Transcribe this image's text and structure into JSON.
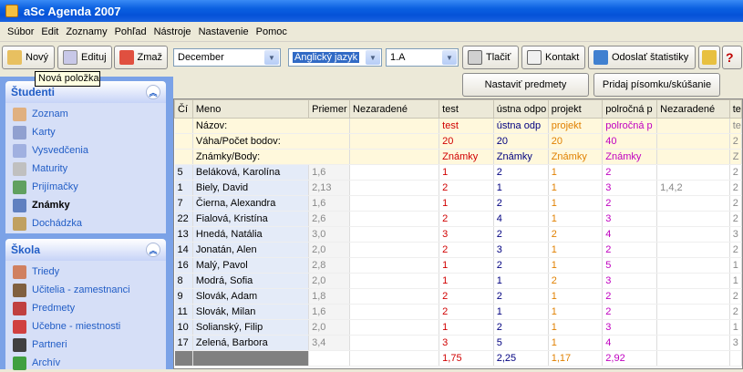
{
  "window": {
    "title": "aSc Agenda 2007"
  },
  "menu": [
    "Súbor",
    "Edit",
    "Zoznamy",
    "Pohľad",
    "Nástroje",
    "Nastavenie",
    "Pomoc"
  ],
  "toolbar": {
    "new": "Nový",
    "edit": "Edituj",
    "delete": "Zmaž",
    "month": "December",
    "subject": "Anglický jazyk",
    "class": "1.A",
    "print": "Tlačiť",
    "contact": "Kontakt",
    "send_stats": "Odoslať štatistiky",
    "set_subjects": "Nastaviť predmety",
    "add_exam": "Pridaj písomku/skúšanie",
    "tooltip": "Nová položka"
  },
  "sidebar": {
    "students_title": "Študenti",
    "students": [
      "Zoznam",
      "Karty",
      "Vysvedčenia",
      "Maturity",
      "Prijímačky",
      "Známky",
      "Dochádzka"
    ],
    "school_title": "Škola",
    "school": [
      "Triedy",
      "Učitelia - zamestnanci",
      "Predmety",
      "Učebne - miestnosti",
      "Partneri",
      "Archív"
    ]
  },
  "grid": {
    "headers": [
      "Čí",
      "Meno",
      "Priemer",
      "Nezaradené",
      "test",
      "ústna odpo",
      "projekt",
      "polročná p",
      "Nezaradené",
      "te"
    ],
    "meta": [
      {
        "label": "Názov:",
        "vals": [
          "test",
          "ústna odp",
          "projekt",
          "polročná p",
          "",
          "te"
        ]
      },
      {
        "label": "Váha/Počet bodov:",
        "vals": [
          "20",
          "20",
          "20",
          "40",
          "",
          "2"
        ]
      },
      {
        "label": "Známky/Body:",
        "vals": [
          "Známky",
          "Známky",
          "Známky",
          "Známky",
          "",
          "Z"
        ]
      }
    ],
    "rows": [
      {
        "n": "5",
        "name": "Beláková, Karolína",
        "avg": "1,6",
        "nez": "",
        "t": "1",
        "u": "2",
        "p": "1",
        "pol": "2",
        "nez2": "",
        "x": "2"
      },
      {
        "n": "1",
        "name": "Biely, David",
        "avg": "2,13",
        "nez": "",
        "t": "2",
        "u": "1",
        "p": "1",
        "pol": "3",
        "nez2": "1,4,2",
        "x": "2"
      },
      {
        "n": "7",
        "name": "Čierna, Alexandra",
        "avg": "1,6",
        "nez": "",
        "t": "1",
        "u": "2",
        "p": "1",
        "pol": "2",
        "nez2": "",
        "x": "2"
      },
      {
        "n": "22",
        "name": "Fialová, Kristína",
        "avg": "2,6",
        "nez": "",
        "t": "2",
        "u": "4",
        "p": "1",
        "pol": "3",
        "nez2": "",
        "x": "2"
      },
      {
        "n": "13",
        "name": "Hnedá, Natália",
        "avg": "3,0",
        "nez": "",
        "t": "3",
        "u": "2",
        "p": "2",
        "pol": "4",
        "nez2": "",
        "x": "3"
      },
      {
        "n": "14",
        "name": "Jonatán, Alen",
        "avg": "2,0",
        "nez": "",
        "t": "2",
        "u": "3",
        "p": "1",
        "pol": "2",
        "nez2": "",
        "x": "2"
      },
      {
        "n": "16",
        "name": "Malý, Pavol",
        "avg": "2,8",
        "nez": "",
        "t": "1",
        "u": "2",
        "p": "1",
        "pol": "5",
        "nez2": "",
        "x": "1"
      },
      {
        "n": "8",
        "name": "Modrá, Sofia",
        "avg": "2,0",
        "nez": "",
        "t": "1",
        "u": "1",
        "p": "2",
        "pol": "3",
        "nez2": "",
        "x": "1"
      },
      {
        "n": "9",
        "name": "Slovák, Adam",
        "avg": "1,8",
        "nez": "",
        "t": "2",
        "u": "2",
        "p": "1",
        "pol": "2",
        "nez2": "",
        "x": "2"
      },
      {
        "n": "11",
        "name": "Slovák, Milan",
        "avg": "1,6",
        "nez": "",
        "t": "2",
        "u": "1",
        "p": "1",
        "pol": "2",
        "nez2": "",
        "x": "2"
      },
      {
        "n": "10",
        "name": "Solianský, Filip",
        "avg": "2,0",
        "nez": "",
        "t": "1",
        "u": "2",
        "p": "1",
        "pol": "3",
        "nez2": "",
        "x": "1"
      },
      {
        "n": "17",
        "name": "Zelená, Barbora",
        "avg": "3,4",
        "nez": "",
        "t": "3",
        "u": "5",
        "p": "1",
        "pol": "4",
        "nez2": "",
        "x": "3"
      }
    ],
    "summary": {
      "t": "1,75",
      "u": "2,25",
      "p": "1,17",
      "pol": "2,92"
    }
  }
}
